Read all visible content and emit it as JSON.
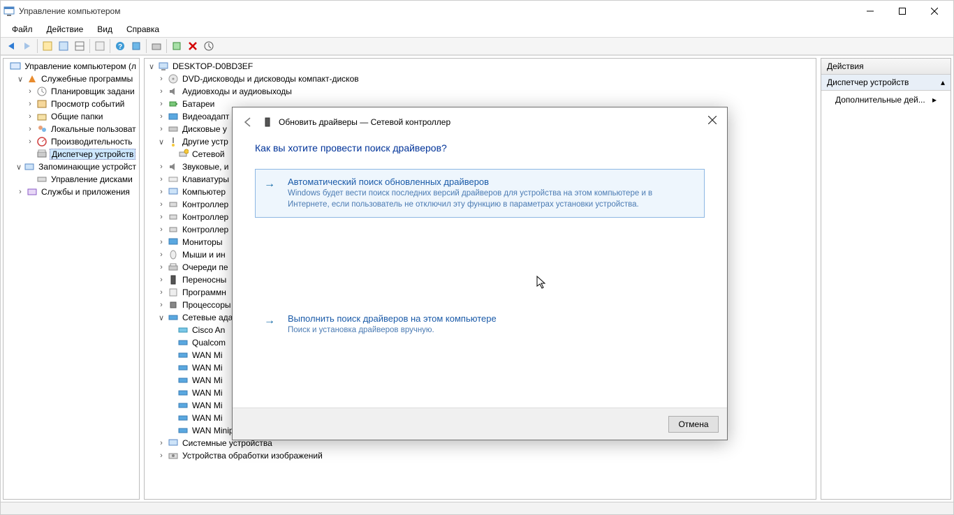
{
  "window": {
    "title": "Управление компьютером"
  },
  "menubar": {
    "file": "Файл",
    "action": "Действие",
    "view": "Вид",
    "help": "Справка"
  },
  "leftTree": {
    "root": "Управление компьютером (л",
    "systemTools": "Служебные программы",
    "scheduler": "Планировщик задани",
    "eventViewer": "Просмотр событий",
    "sharedFolders": "Общие папки",
    "localUsers": "Локальные пользоват",
    "performance": "Производительность",
    "deviceManager": "Диспетчер устройств",
    "storage": "Запоминающие устройст",
    "diskMgmt": "Управление дисками",
    "services": "Службы и приложения"
  },
  "centerTree": {
    "root": "DESKTOP-D0BD3EF",
    "dvd": "DVD-дисководы и дисководы компакт-дисков",
    "audio": "Аудиовходы и аудиовыходы",
    "batteries": "Батареи",
    "video": "Видеоадапт",
    "disks": "Дисковые у",
    "other": "Другие устр",
    "netController": "Сетевой",
    "sound": "Звуковые, и",
    "keyboards": "Клавиатуры",
    "computer": "Компьютер",
    "controllers1": "Контроллер",
    "controllers2": "Контроллер",
    "controllers3": "Контроллер",
    "monitors": "Мониторы",
    "mice": "Мыши и ин",
    "printQueues": "Очереди пе",
    "portable": "Переносны",
    "software": "Программн",
    "processors": "Процессоры",
    "netAdapters": "Сетевые ада",
    "ciscoAn": "Cisco An",
    "qualcom": "Qualcom",
    "wanMi1": "WAN Mi",
    "wanMi2": "WAN Mi",
    "wanMi3": "WAN Mi",
    "wanMi4": "WAN Mi",
    "wanMi5": "WAN Mi",
    "wanMi6": "WAN Mi",
    "wanMi7": "WAN Miniport (SSTP)",
    "systemDevices": "Системные устройства",
    "imaging": "Устройства обработки изображений"
  },
  "actions": {
    "header": "Действия",
    "sub": "Диспетчер устройств",
    "more": "Дополнительные дей..."
  },
  "dialog": {
    "title": "Обновить драйверы — Сетевой контроллер",
    "question": "Как вы хотите провести поиск драйверов?",
    "opt1_title": "Автоматический поиск обновленных драйверов",
    "opt1_desc": "Windows будет вести поиск последних версий драйверов для устройства на этом компьютере и в Интернете, если пользователь не отключил эту функцию в параметрах установки устройства.",
    "opt2_title": "Выполнить поиск драйверов на этом компьютере",
    "opt2_desc": "Поиск и установка драйверов вручную.",
    "cancel": "Отмена"
  }
}
